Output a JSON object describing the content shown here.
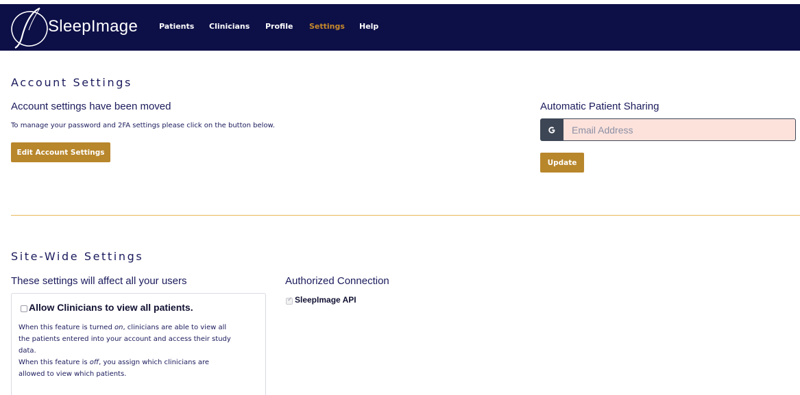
{
  "nav": {
    "brand": "SleepImage",
    "items": [
      {
        "label": "Patients",
        "active": false
      },
      {
        "label": "Clinicians",
        "active": false
      },
      {
        "label": "Profile",
        "active": false
      },
      {
        "label": "Settings",
        "active": true
      },
      {
        "label": "Help",
        "active": false
      }
    ]
  },
  "account": {
    "heading": "Account Settings",
    "moved_title": "Account settings have been moved",
    "moved_text": "To manage your password and 2FA settings please click on the button below.",
    "edit_button": "Edit Account Settings"
  },
  "sharing": {
    "title": "Automatic Patient Sharing",
    "email_placeholder": "Email Address",
    "email_value": "",
    "addon_icon": "google-icon",
    "update_button": "Update"
  },
  "site": {
    "heading": "Site-Wide Settings",
    "subtitle": "These settings will affect all your users",
    "card": {
      "checkbox_label": "Allow Clinicians to view all patients.",
      "checked": false,
      "on_prefix": "When this feature is turned ",
      "on_word": "on",
      "on_suffix": ", clinicians are able to view all",
      "on_line2": "the patients entered into your account and access their study",
      "on_line3": "data.",
      "off_prefix": "When this feature is ",
      "off_word": "off",
      "off_suffix": ", you assign which clinicians are",
      "off_line2": "allowed to view which patients."
    }
  },
  "connections": {
    "title": "Authorized Connection",
    "items": [
      {
        "label": "SleepImage API",
        "checked": true
      }
    ]
  },
  "colors": {
    "navbar": "#0d0f47",
    "accent": "#c78a2a",
    "button": "#b8862b",
    "text": "#1a1a5c",
    "input_bg": "#fde2dc"
  }
}
